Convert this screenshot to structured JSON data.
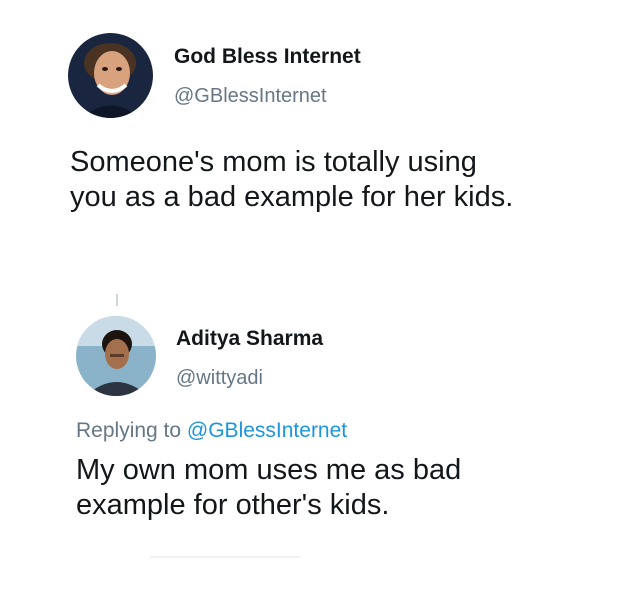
{
  "tweet": {
    "author": {
      "name": "God Bless Internet",
      "handle": "@GBlessInternet",
      "avatar_icon": "profile-photo-icon"
    },
    "text_line1": "Someone's mom is totally using",
    "text_line2": "you as a bad example for her kids."
  },
  "reply": {
    "author": {
      "name": "Aditya Sharma",
      "handle": "@wittyadi",
      "avatar_icon": "profile-photo-icon"
    },
    "replying_prefix": "Replying to",
    "replying_to": "@GBlessInternet",
    "text_line1": "My own mom uses me as bad",
    "text_line2": "example for other's kids."
  },
  "colors": {
    "text": "#14171a",
    "secondary": "#657786",
    "link": "#1b95e0"
  }
}
